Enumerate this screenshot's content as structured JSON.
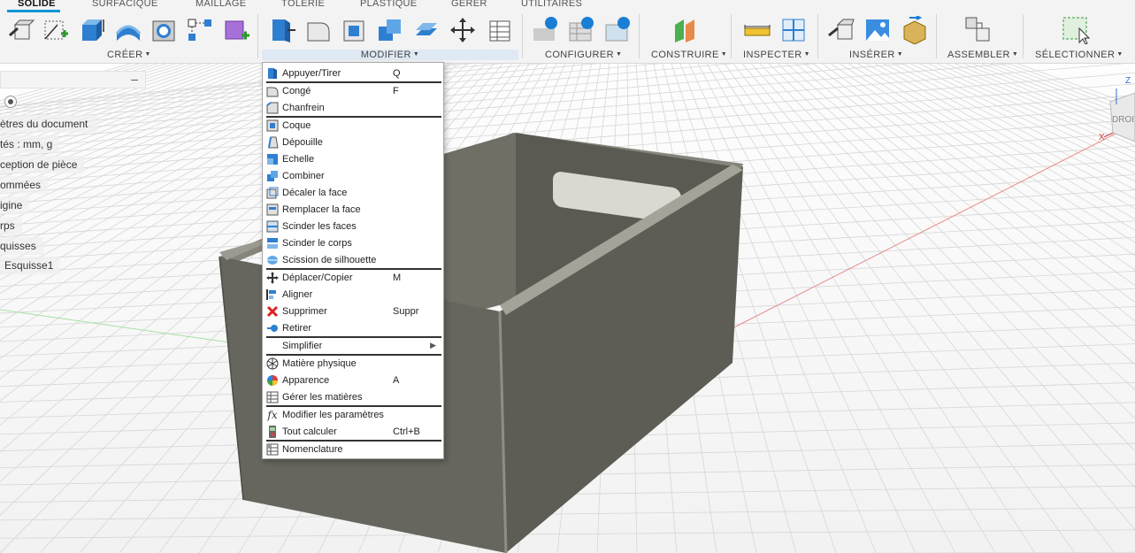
{
  "tabs": [
    {
      "label": "SOLIDE",
      "active": true
    },
    {
      "label": "SURFACIQUE"
    },
    {
      "label": "MAILLAGE"
    },
    {
      "label": "TÔLERIE"
    },
    {
      "label": "PLASTIQUE"
    },
    {
      "label": "GÉRER"
    },
    {
      "label": "UTILITAIRES"
    }
  ],
  "groups": {
    "create": "CRÉER",
    "modify": "MODIFIER",
    "configure": "CONFIGURER",
    "construct": "CONSTRUIRE",
    "inspect": "INSPECTER",
    "insert": "INSÉRER",
    "assemble": "ASSEMBLER",
    "select": "SÉLECTIONNER"
  },
  "browser": {
    "collapse": "–",
    "items": [
      "ètres du document",
      "tés : mm, g",
      "ception de pièce",
      "ommées",
      "igine",
      "rps",
      "quisses",
      "Esquisse1"
    ]
  },
  "menu": {
    "items": [
      {
        "label": "Appuyer/Tirer",
        "shortcut": "Q",
        "icon": "press-pull-icon"
      },
      {
        "label": "Congé",
        "shortcut": "F",
        "icon": "fillet-icon"
      },
      {
        "label": "Chanfrein",
        "shortcut": "",
        "icon": "chamfer-icon"
      },
      {
        "label": "Coque",
        "shortcut": "",
        "icon": "shell-icon"
      },
      {
        "label": "Dépouille",
        "shortcut": "",
        "icon": "draft-icon"
      },
      {
        "label": "Echelle",
        "shortcut": "",
        "icon": "scale-icon"
      },
      {
        "label": "Combiner",
        "shortcut": "",
        "icon": "combine-icon"
      },
      {
        "label": "Décaler la face",
        "shortcut": "",
        "icon": "offset-face-icon"
      },
      {
        "label": "Remplacer la face",
        "shortcut": "",
        "icon": "replace-face-icon"
      },
      {
        "label": "Scinder les faces",
        "shortcut": "",
        "icon": "split-face-icon"
      },
      {
        "label": "Scinder le corps",
        "shortcut": "",
        "icon": "split-body-icon"
      },
      {
        "label": "Scission de silhouette",
        "shortcut": "",
        "icon": "silhouette-split-icon"
      },
      {
        "label": "Déplacer/Copier",
        "shortcut": "M",
        "icon": "move-icon"
      },
      {
        "label": "Aligner",
        "shortcut": "",
        "icon": "align-icon"
      },
      {
        "label": "Supprimer",
        "shortcut": "Suppr",
        "icon": "delete-icon"
      },
      {
        "label": "Retirer",
        "shortcut": "",
        "icon": "remove-icon"
      },
      {
        "label": "Simplifier",
        "shortcut": "",
        "icon": "simplify-icon"
      },
      {
        "label": "Matière physique",
        "shortcut": "",
        "icon": "physical-material-icon"
      },
      {
        "label": "Apparence",
        "shortcut": "A",
        "icon": "appearance-icon"
      },
      {
        "label": "Gérer les matières",
        "shortcut": "",
        "icon": "manage-materials-icon"
      },
      {
        "label": "Modifier les paramètres",
        "shortcut": "",
        "icon": "change-parameters-icon"
      },
      {
        "label": "Tout calculer",
        "shortcut": "Ctrl+B",
        "icon": "compute-all-icon"
      },
      {
        "label": "Nomenclature",
        "shortcut": "",
        "icon": "bill-of-materials-icon"
      }
    ]
  },
  "viewcube": {
    "face": "DROIT",
    "axis_z": "Z",
    "axis_x": "X"
  },
  "colors": {
    "accent": "#0696d7",
    "highlight": "#fff44a",
    "body": "#6b6b62"
  }
}
